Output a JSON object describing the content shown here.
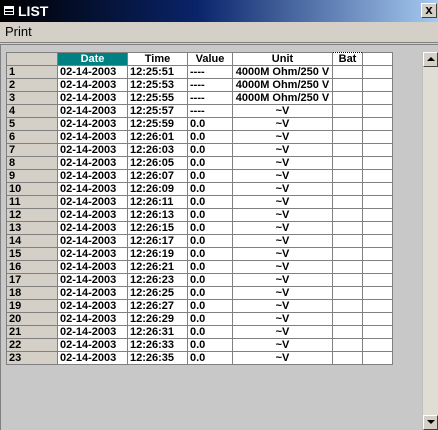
{
  "window": {
    "title": "LIST",
    "close_label": "x"
  },
  "menu": {
    "print_label": "Print"
  },
  "table": {
    "columns": [
      "",
      "Date",
      "Time",
      "Value",
      "Unit",
      "Bat"
    ],
    "rows": [
      {
        "n": "1",
        "date": "02-14-2003",
        "time": "12:25:51",
        "value": "----",
        "unit": "4000M Ohm/250 V",
        "bat": ""
      },
      {
        "n": "2",
        "date": "02-14-2003",
        "time": "12:25:53",
        "value": "----",
        "unit": "4000M Ohm/250 V",
        "bat": ""
      },
      {
        "n": "3",
        "date": "02-14-2003",
        "time": "12:25:55",
        "value": "----",
        "unit": "4000M Ohm/250 V",
        "bat": ""
      },
      {
        "n": "4",
        "date": "02-14-2003",
        "time": "12:25:57",
        "value": "----",
        "unit": "~V",
        "bat": ""
      },
      {
        "n": "5",
        "date": "02-14-2003",
        "time": "12:25:59",
        "value": "0.0",
        "unit": "~V",
        "bat": ""
      },
      {
        "n": "6",
        "date": "02-14-2003",
        "time": "12:26:01",
        "value": "0.0",
        "unit": "~V",
        "bat": ""
      },
      {
        "n": "7",
        "date": "02-14-2003",
        "time": "12:26:03",
        "value": "0.0",
        "unit": "~V",
        "bat": ""
      },
      {
        "n": "8",
        "date": "02-14-2003",
        "time": "12:26:05",
        "value": "0.0",
        "unit": "~V",
        "bat": ""
      },
      {
        "n": "9",
        "date": "02-14-2003",
        "time": "12:26:07",
        "value": "0.0",
        "unit": "~V",
        "bat": ""
      },
      {
        "n": "10",
        "date": "02-14-2003",
        "time": "12:26:09",
        "value": "0.0",
        "unit": "~V",
        "bat": ""
      },
      {
        "n": "11",
        "date": "02-14-2003",
        "time": "12:26:11",
        "value": "0.0",
        "unit": "~V",
        "bat": ""
      },
      {
        "n": "12",
        "date": "02-14-2003",
        "time": "12:26:13",
        "value": "0.0",
        "unit": "~V",
        "bat": ""
      },
      {
        "n": "13",
        "date": "02-14-2003",
        "time": "12:26:15",
        "value": "0.0",
        "unit": "~V",
        "bat": ""
      },
      {
        "n": "14",
        "date": "02-14-2003",
        "time": "12:26:17",
        "value": "0.0",
        "unit": "~V",
        "bat": ""
      },
      {
        "n": "15",
        "date": "02-14-2003",
        "time": "12:26:19",
        "value": "0.0",
        "unit": "~V",
        "bat": ""
      },
      {
        "n": "16",
        "date": "02-14-2003",
        "time": "12:26:21",
        "value": "0.0",
        "unit": "~V",
        "bat": ""
      },
      {
        "n": "17",
        "date": "02-14-2003",
        "time": "12:26:23",
        "value": "0.0",
        "unit": "~V",
        "bat": ""
      },
      {
        "n": "18",
        "date": "02-14-2003",
        "time": "12:26:25",
        "value": "0.0",
        "unit": "~V",
        "bat": ""
      },
      {
        "n": "19",
        "date": "02-14-2003",
        "time": "12:26:27",
        "value": "0.0",
        "unit": "~V",
        "bat": ""
      },
      {
        "n": "20",
        "date": "02-14-2003",
        "time": "12:26:29",
        "value": "0.0",
        "unit": "~V",
        "bat": ""
      },
      {
        "n": "21",
        "date": "02-14-2003",
        "time": "12:26:31",
        "value": "0.0",
        "unit": "~V",
        "bat": ""
      },
      {
        "n": "22",
        "date": "02-14-2003",
        "time": "12:26:33",
        "value": "0.0",
        "unit": "~V",
        "bat": ""
      },
      {
        "n": "23",
        "date": "02-14-2003",
        "time": "12:26:35",
        "value": "0.0",
        "unit": "~V",
        "bat": ""
      }
    ]
  },
  "colors": {
    "selected_header": "#008080",
    "titlebar_start": "#000000",
    "titlebar_mid": "#0a246a"
  }
}
